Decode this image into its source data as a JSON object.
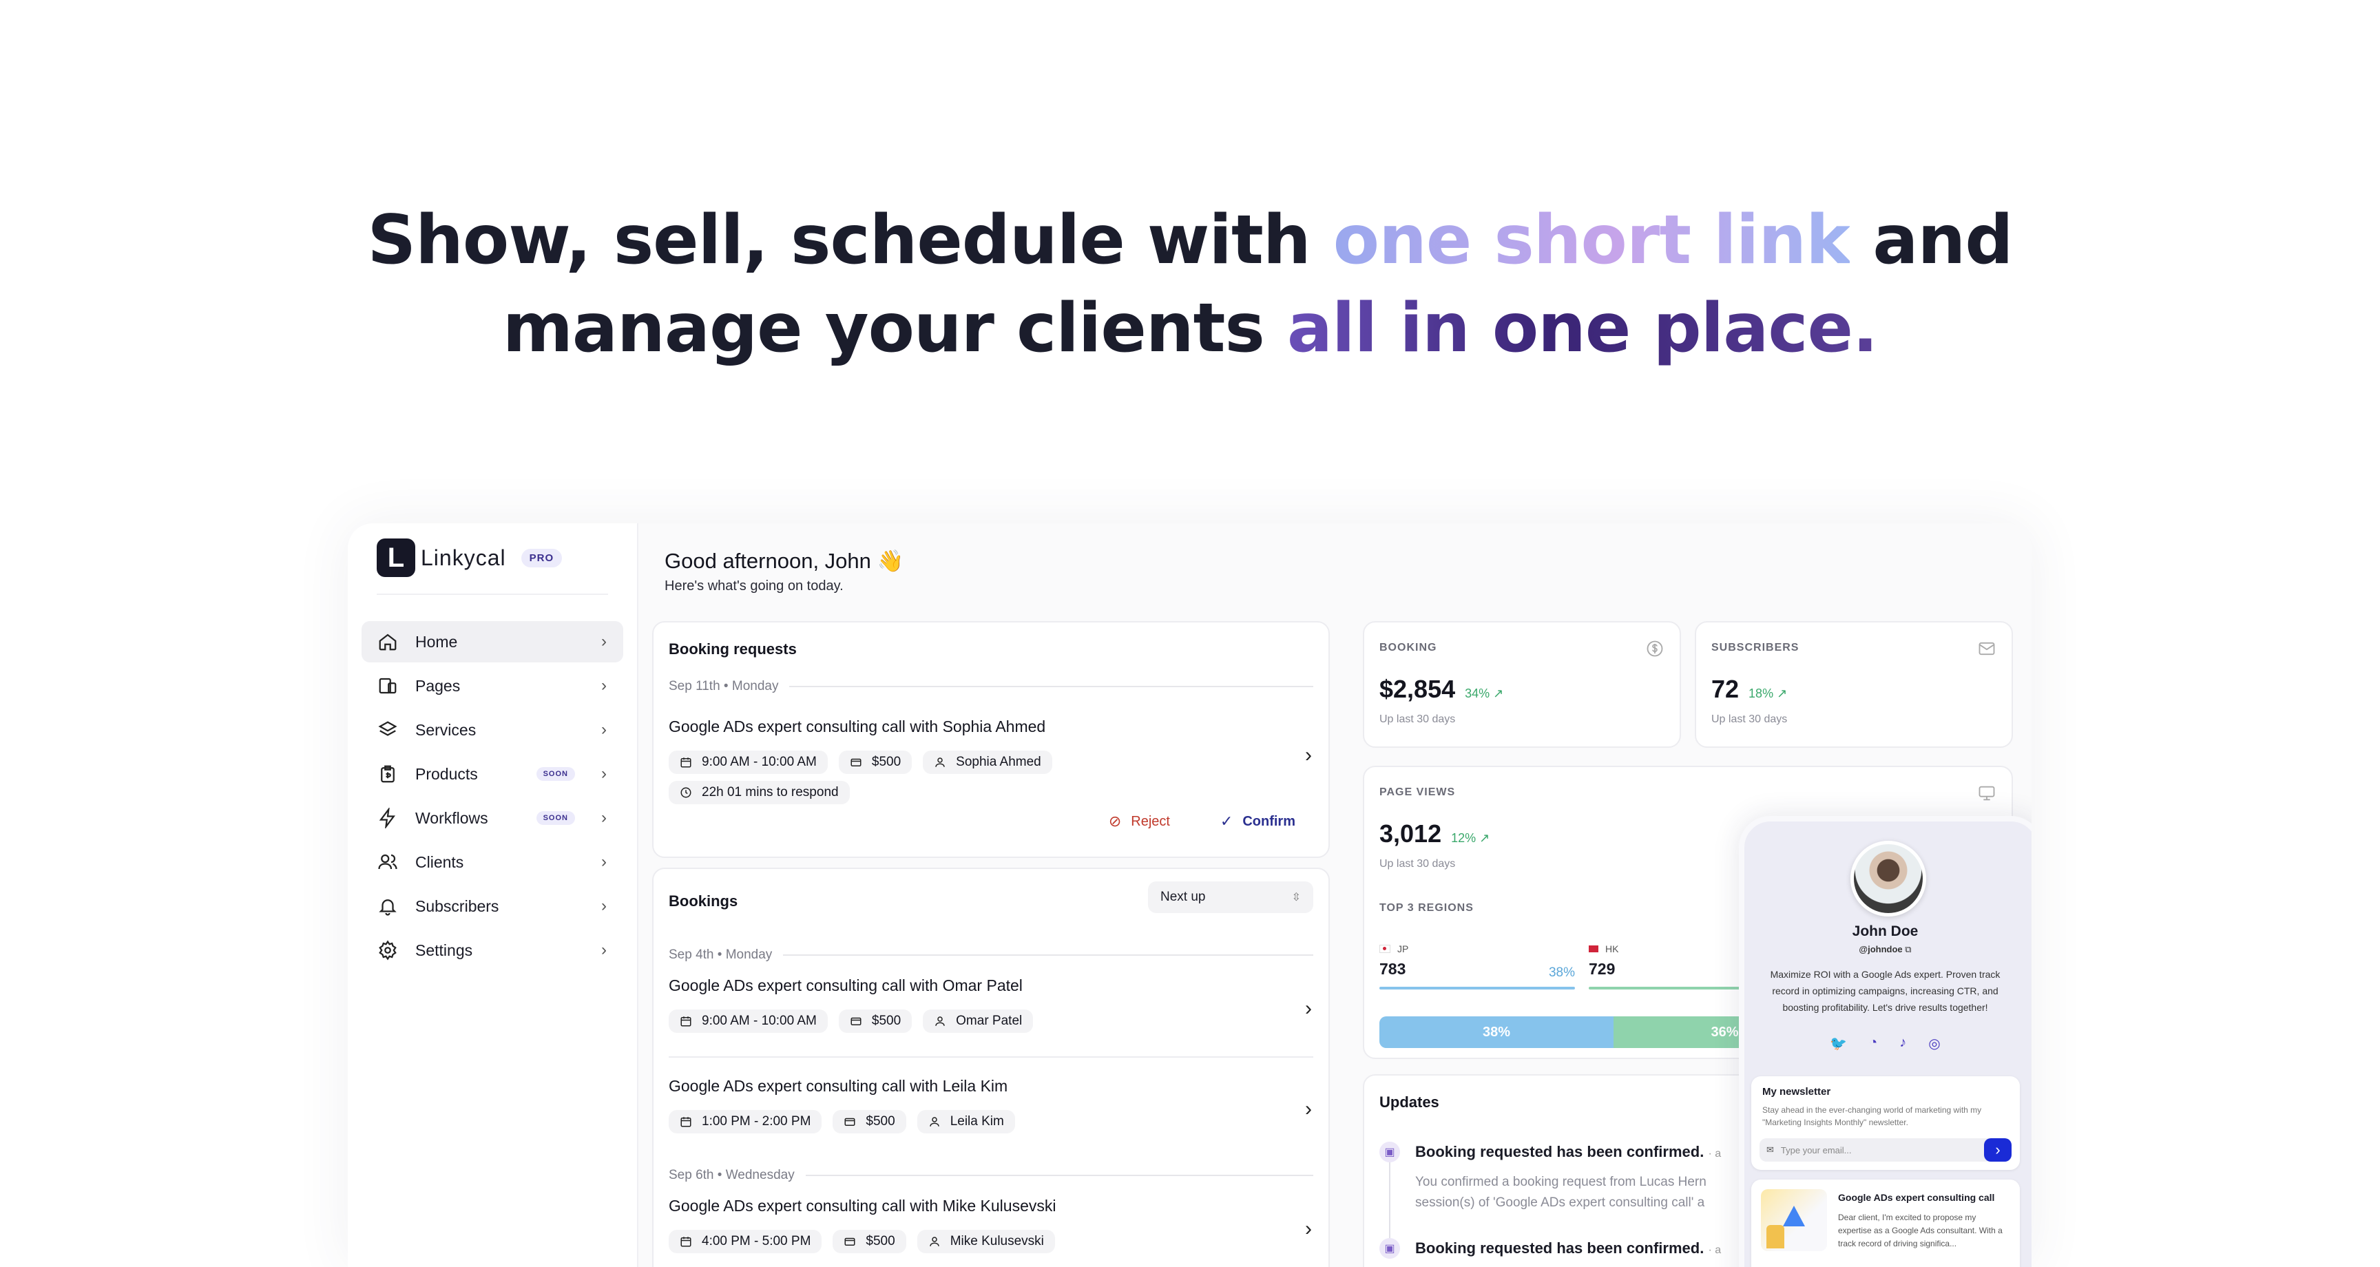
{
  "hero": {
    "line1_a": "Show, sell, schedule with ",
    "line1_grad": "one short link",
    "line1_b": " and",
    "line2_a": "manage your clients ",
    "line2_grad": "all in one place."
  },
  "brand": {
    "name": "Linkycal",
    "badge": "PRO",
    "logo_letter": "L"
  },
  "nav": [
    {
      "label": "Home",
      "icon": "home-icon"
    },
    {
      "label": "Pages",
      "icon": "pages-icon"
    },
    {
      "label": "Services",
      "icon": "layers-icon"
    },
    {
      "label": "Products",
      "icon": "product-tag-icon",
      "badge": "SOON"
    },
    {
      "label": "Workflows",
      "icon": "lightning-icon",
      "badge": "SOON"
    },
    {
      "label": "Clients",
      "icon": "users-icon"
    },
    {
      "label": "Subscribers",
      "icon": "bell-icon"
    },
    {
      "label": "Settings",
      "icon": "gear-icon"
    }
  ],
  "greeting": {
    "title": "Good afternoon, John 👋",
    "subtitle": "Here's what's going on today."
  },
  "booking_requests": {
    "title": "Booking requests",
    "date": "Sep 11th • Monday",
    "item": {
      "title": "Google ADs expert consulting call with Sophia Ahmed",
      "time": "9:00 AM - 10:00 AM",
      "price": "$500",
      "client": "Sophia Ahmed",
      "respond": "22h 01 mins to respond"
    },
    "reject": "Reject",
    "confirm": "Confirm"
  },
  "bookings": {
    "title": "Bookings",
    "filter": "Next up",
    "date1": "Sep 4th • Monday",
    "date2": "Sep 6th • Wednesday",
    "items": [
      {
        "title": "Google ADs expert consulting call with Omar Patel",
        "time": "9:00 AM - 10:00 AM",
        "price": "$500",
        "client": "Omar Patel"
      },
      {
        "title": "Google ADs expert consulting call with Leila Kim",
        "time": "1:00 PM - 2:00 PM",
        "price": "$500",
        "client": "Leila Kim"
      },
      {
        "title": "Google ADs expert consulting call with Mike Kulusevski",
        "time": "4:00 PM - 5:00 PM",
        "price": "$500",
        "client": "Mike Kulusevski"
      }
    ]
  },
  "stats": {
    "booking": {
      "label": "BOOKING",
      "value": "$2,854",
      "pct": "34% ↗",
      "sub": "Up last 30 days"
    },
    "subscribers": {
      "label": "SUBSCRIBERS",
      "value": "72",
      "pct": "18% ↗",
      "sub": "Up last 30 days"
    },
    "page_views": {
      "label": "PAGE VIEWS",
      "value": "3,012",
      "pct": "12% ↗",
      "sub": "Up last 30 days"
    }
  },
  "regions": {
    "title": "TOP 3 REGIONS",
    "items": [
      {
        "code": "JP",
        "value": "783",
        "pct": "38%",
        "share": 0.38,
        "color": "#86c3ec"
      },
      {
        "code": "HK",
        "value": "729",
        "pct": "36%",
        "share": 0.36,
        "color": "#8fd3ac"
      }
    ]
  },
  "updates": {
    "title": "Updates",
    "items": [
      {
        "title": "Booking requested has been confirmed.",
        "tail": "· a",
        "body1": "You confirmed a booking request from Lucas Hern",
        "body2": "session(s) of 'Google ADs expert consulting call' a"
      },
      {
        "title": "Booking requested has been confirmed.",
        "tail": "· a"
      }
    ]
  },
  "profile": {
    "name": "John Doe",
    "handle": "@johndoe",
    "bio": "Maximize ROI with a Google Ads expert. Proven track record in optimizing campaigns, increasing CTR, and boosting profitability. Let's drive results together!",
    "social_icons": [
      "twitter-icon",
      "whatsapp-icon",
      "tiktok-icon",
      "instagram-icon"
    ],
    "newsletter": {
      "title": "My newsletter",
      "desc": "Stay ahead in the ever-changing world of marketing with my \"Marketing Insights Monthly\" newsletter.",
      "placeholder": "Type your email..."
    },
    "service": {
      "title": "Google ADs expert consulting call",
      "desc": "Dear client, I'm excited to propose my expertise as a Google Ads consultant. With a track record of driving significa..."
    }
  },
  "colors": {
    "accent": "#3b2f8e",
    "confirm": "#2a2f8f",
    "reject": "#c0392b",
    "positive": "#3aa86b",
    "send_button": "#1a2bd6"
  }
}
